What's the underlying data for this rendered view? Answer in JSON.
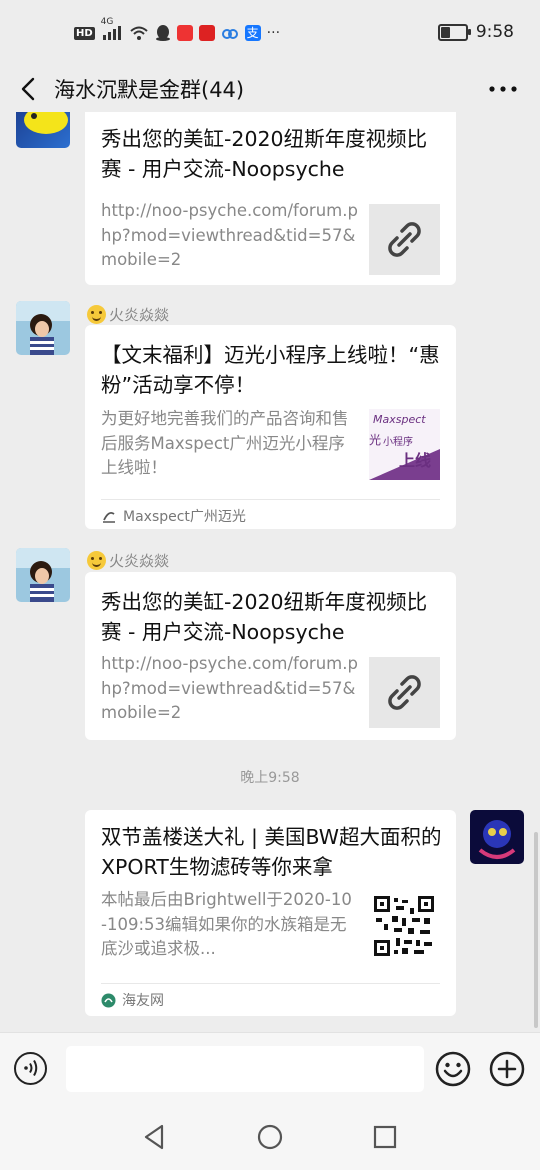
{
  "status_bar": {
    "network_badge": "HD",
    "signal_label": "4G",
    "time": "9:58",
    "battery_level": 0.35
  },
  "header": {
    "title": "海水沉默是金群(44)"
  },
  "messages": [
    {
      "type": "link",
      "title": "秀出您的美缸-2020纽斯年度视频比赛 - 用户交流-Noopsyche",
      "description": "http://noo-psyche.com/forum.php?mod=viewthread&tid=57&mobile=2",
      "thumb_icon": "link-icon"
    },
    {
      "type": "mini-program",
      "sender": "火炎焱燚",
      "title": "【文末福利】迈光小程序上线啦！“惠粉”活动享不停！",
      "description": "为更好地完善我们的产品咨询和售后服务Maxspect广州迈光小程序上线啦！",
      "thumb_text": [
        "Maxspect",
        "光",
        "小程序",
        "上线"
      ],
      "source": "Maxspect广州迈光"
    },
    {
      "type": "link",
      "sender": "火炎焱燚",
      "title": "秀出您的美缸-2020纽斯年度视频比赛 - 用户交流-Noopsyche",
      "description": "http://noo-psyche.com/forum.php?mod=viewthread&tid=57&mobile=2",
      "thumb_icon": "link-icon"
    },
    {
      "type": "timestamp",
      "text": "晚上9:58"
    },
    {
      "type": "mini-program",
      "title": "双节盖楼送大礼 | 美国BW超大面积的XPORT生物滤砖等你来拿",
      "description": "本帖最后由Brightwell于2020-10-109:53编辑如果你的水族箱是无底沙或追求极...",
      "thumb_icon": "qr-code-icon",
      "source": "海友网"
    }
  ],
  "input_bar": {
    "placeholder": ""
  },
  "colors": {
    "background": "#ededed",
    "card": "#ffffff",
    "purple_thumb": "#7a3e8f"
  }
}
